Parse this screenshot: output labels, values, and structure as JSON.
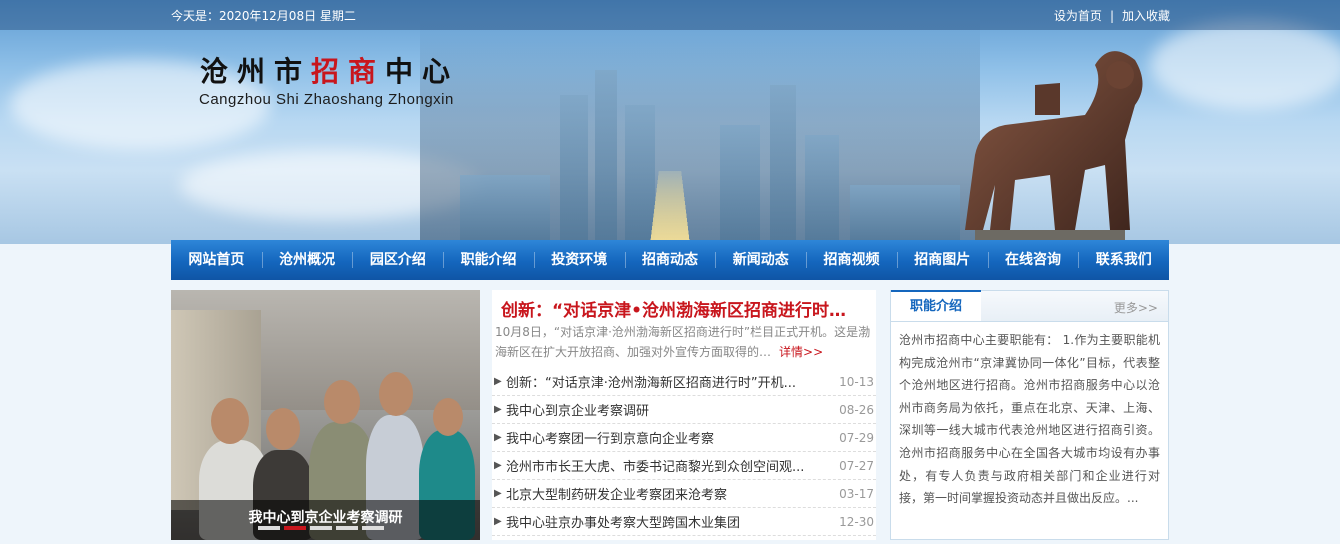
{
  "topbar": {
    "date_text": "今天是：2020年12月08日 星期二",
    "set_home": "设为首页",
    "separator": "|",
    "add_favorite": "加入收藏"
  },
  "logo": {
    "cn_part1": "沧州市",
    "cn_red": "招商",
    "cn_part2": "中心",
    "en": "Cangzhou Shi Zhaoshang Zhongxin"
  },
  "nav": {
    "items": [
      "网站首页",
      "沧州概况",
      "园区介绍",
      "职能介绍",
      "投资环境",
      "招商动态",
      "新闻动态",
      "招商视频",
      "招商图片",
      "在线咨询",
      "联系我们"
    ]
  },
  "slider": {
    "caption": "我中心到京企业考察调研",
    "dot_count": 5,
    "active_dot": 2
  },
  "news": {
    "headline": "创新：“对话京津•沧州渤海新区招商进行时…",
    "summary": "10月8日，“对话京津·沧州渤海新区招商进行时”栏目正式开机。这是渤海新区在扩大开放招商、加强对外宣传方面取得的…",
    "detail_label": "详情>>",
    "items": [
      {
        "title": "创新：“对话京津·沧州渤海新区招商进行时”开机...",
        "date": "10-13"
      },
      {
        "title": "我中心到京企业考察调研",
        "date": "08-26"
      },
      {
        "title": "我中心考察团一行到京意向企业考察",
        "date": "07-29"
      },
      {
        "title": "沧州市市长王大虎、市委书记商黎光到众创空间观...",
        "date": "07-27"
      },
      {
        "title": "北京大型制药研发企业考察团来沧考察",
        "date": "03-17"
      },
      {
        "title": "我中心驻京办事处考察大型跨国木业集团",
        "date": "12-30"
      }
    ]
  },
  "panel": {
    "tab_label": "职能介绍",
    "more_label": "更多>>",
    "body": "沧州市招商中心主要职能有： 1.作为主要职能机构完成沧州市“京津冀协同一体化”目标，代表整个沧州地区进行招商。沧州市招商服务中心以沧州市商务局为依托，重点在北京、天津、上海、深圳等一线大城市代表沧州地区进行招商引资。沧州市招商服务中心在全国各大城市均设有办事处，有专人负责与政府相关部门和企业进行对接，第一时间掌握投资动态并且做出反应。..."
  }
}
